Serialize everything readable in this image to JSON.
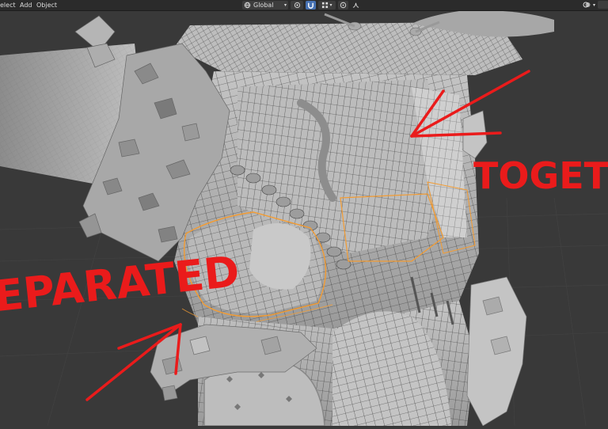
{
  "header": {
    "menu": [
      "elect",
      "Add",
      "Object"
    ],
    "orientation": "Global"
  },
  "icons": {
    "orientation": "global-transform-icon",
    "pivot": "pivot-point-icon",
    "snap": "snap-magnet-icon",
    "snap_target": "snap-increment-icon",
    "proportional": "proportional-editing-icon",
    "falloff": "falloff-curve-icon",
    "overlay": "overlay-icon"
  },
  "annotations": {
    "left_word": "EPARATED",
    "right_word": "TOGET"
  },
  "colors": {
    "background": "#393939",
    "mesh": "#b8b8b8",
    "wire": "#2a2a2a",
    "selection": "#f39c33",
    "annotation": "#ea1b1b"
  }
}
